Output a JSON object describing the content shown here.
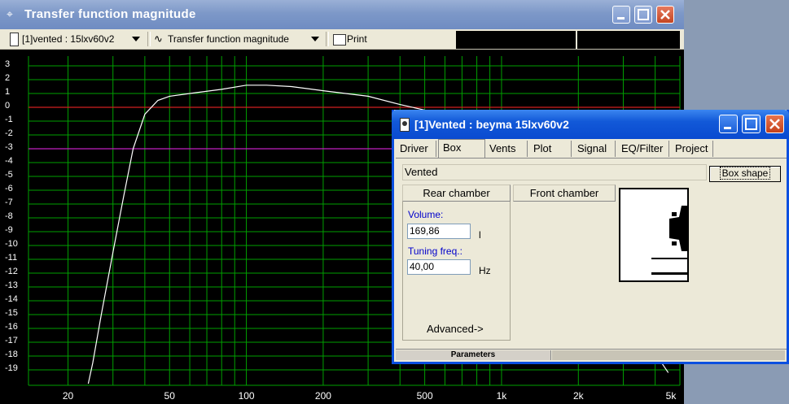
{
  "main_window": {
    "title": "Transfer function magnitude",
    "toolbar": {
      "project_select": "[1]vented : 15lxv60v2",
      "view_select": "Transfer function magnitude",
      "print_label": "Print"
    }
  },
  "chart_data": {
    "type": "line",
    "x_scale": "log",
    "xlim": [
      14,
      5000
    ],
    "ylim": [
      -20,
      3.5
    ],
    "grid": true,
    "x_ticks": [
      "20",
      "50",
      "100",
      "200",
      "500",
      "1k",
      "2k",
      "5k"
    ],
    "y_ticks": [
      "3",
      "2",
      "1",
      "0",
      "-1",
      "-2",
      "-3",
      "-4",
      "-5",
      "-6",
      "-7",
      "-8",
      "-9",
      "-10",
      "-11",
      "-12",
      "-13",
      "-14",
      "-15",
      "-16",
      "-17",
      "-18",
      "-19"
    ],
    "reference_lines": [
      {
        "y": 0,
        "color": "#d02020"
      },
      {
        "y": -3,
        "color": "#c020c0"
      }
    ],
    "series": [
      {
        "color": "#ffffff",
        "x": [
          24,
          25,
          27,
          30,
          33,
          36,
          40,
          45,
          50,
          60,
          80,
          100,
          120,
          150,
          200,
          300,
          400,
          500,
          600,
          2500,
          3000,
          3500,
          4000,
          4500
        ],
        "y": [
          -20,
          -18.5,
          -15,
          -10.5,
          -6.5,
          -3.0,
          -0.5,
          0.5,
          0.8,
          1.0,
          1.3,
          1.6,
          1.6,
          1.5,
          1.2,
          0.8,
          0.2,
          -0.2,
          -0.8,
          -14.5,
          -15.6,
          -16.6,
          -17.8,
          -19.2
        ]
      }
    ],
    "colors": {
      "background": "#000000",
      "grid": "#00a000"
    }
  },
  "dialog": {
    "title": "[1]Vented : beyma 15lxv60v2",
    "tabs": [
      "Driver",
      "Box",
      "Vents",
      "Plot",
      "Signal",
      "EQ/Filter",
      "Project"
    ],
    "active_tab": "Box",
    "box_type": "Vented",
    "box_shape_label": "Box shape",
    "rear_chamber_label": "Rear chamber",
    "front_chamber_label": "Front chamber",
    "volume_label": "Volume:",
    "volume_value": "169,86",
    "volume_unit": "l",
    "tuning_label": "Tuning freq.:",
    "tuning_value": "40,00",
    "tuning_unit": "Hz",
    "advanced_label": "Advanced->",
    "status_parameters": "Parameters"
  }
}
